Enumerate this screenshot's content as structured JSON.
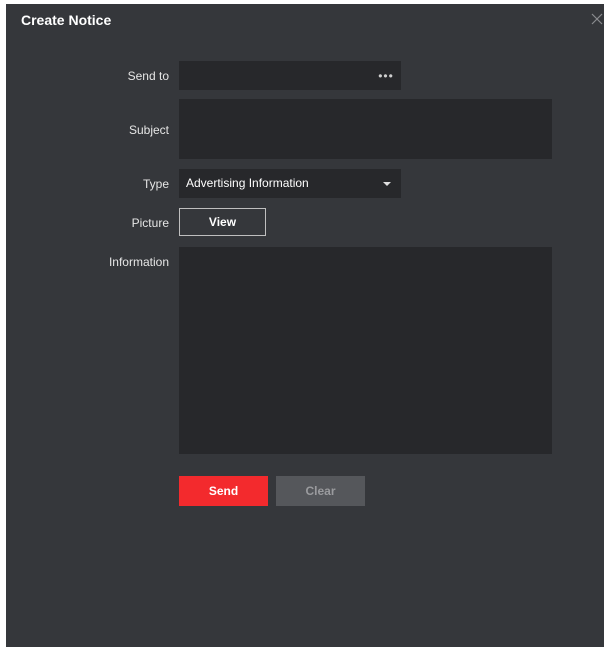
{
  "dialog": {
    "title": "Create Notice",
    "close_icon": "close-icon"
  },
  "form": {
    "send_to": {
      "label": "Send to",
      "value": "",
      "more_label": "•••"
    },
    "subject": {
      "label": "Subject",
      "value": ""
    },
    "type": {
      "label": "Type",
      "selected": "Advertising Information",
      "caret_icon": "caret-down-icon"
    },
    "picture": {
      "label": "Picture",
      "view_label": "View"
    },
    "information": {
      "label": "Information",
      "value": ""
    }
  },
  "actions": {
    "send_label": "Send",
    "clear_label": "Clear"
  },
  "colors": {
    "background": "#35373b",
    "field": "#27282b",
    "accent": "#f32a2d",
    "disabled_button": "#55575b"
  }
}
